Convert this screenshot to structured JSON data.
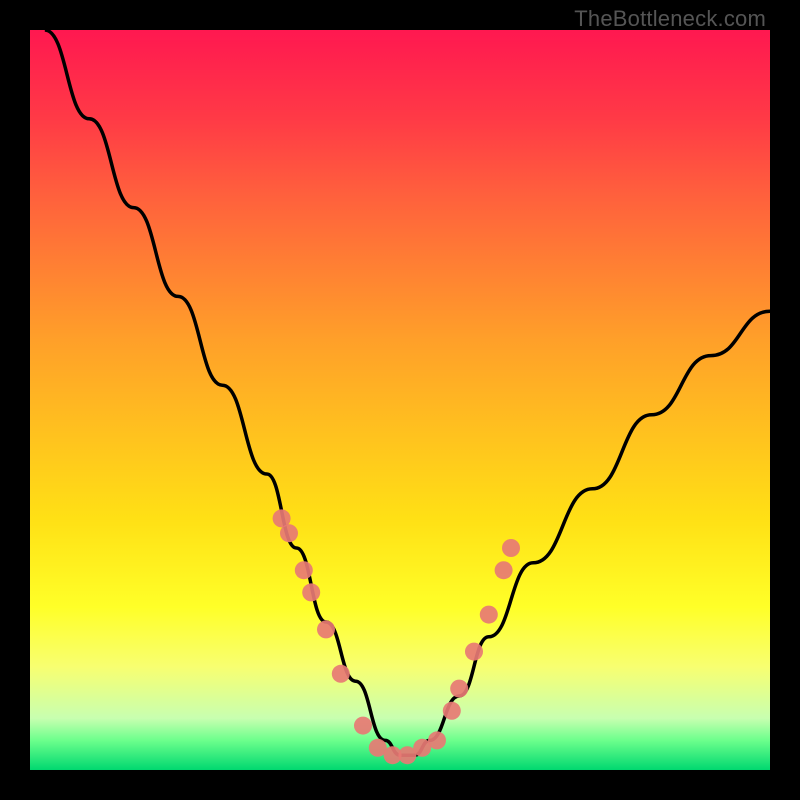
{
  "watermark": "TheBottleneck.com",
  "chart_data": {
    "type": "line",
    "title": "",
    "xlabel": "",
    "ylabel": "",
    "xlim": [
      0,
      100
    ],
    "ylim": [
      0,
      100
    ],
    "series": [
      {
        "name": "bottleneck-curve",
        "x": [
          2,
          8,
          14,
          20,
          26,
          32,
          36,
          40,
          44,
          48,
          50,
          52,
          54,
          58,
          62,
          68,
          76,
          84,
          92,
          100
        ],
        "y": [
          100,
          88,
          76,
          64,
          52,
          40,
          30,
          20,
          12,
          4,
          2,
          2,
          4,
          10,
          18,
          28,
          38,
          48,
          56,
          62
        ]
      }
    ],
    "scatter_points": {
      "name": "highlighted-markers",
      "x": [
        34,
        35,
        37,
        38,
        40,
        42,
        45,
        47,
        49,
        51,
        53,
        55,
        57,
        58,
        60,
        62,
        64,
        65
      ],
      "y": [
        34,
        32,
        27,
        24,
        19,
        13,
        6,
        3,
        2,
        2,
        3,
        4,
        8,
        11,
        16,
        21,
        27,
        30
      ]
    },
    "background_gradient": {
      "top": "#ff1850",
      "mid": "#ffe015",
      "bottom": "#00d870"
    }
  }
}
